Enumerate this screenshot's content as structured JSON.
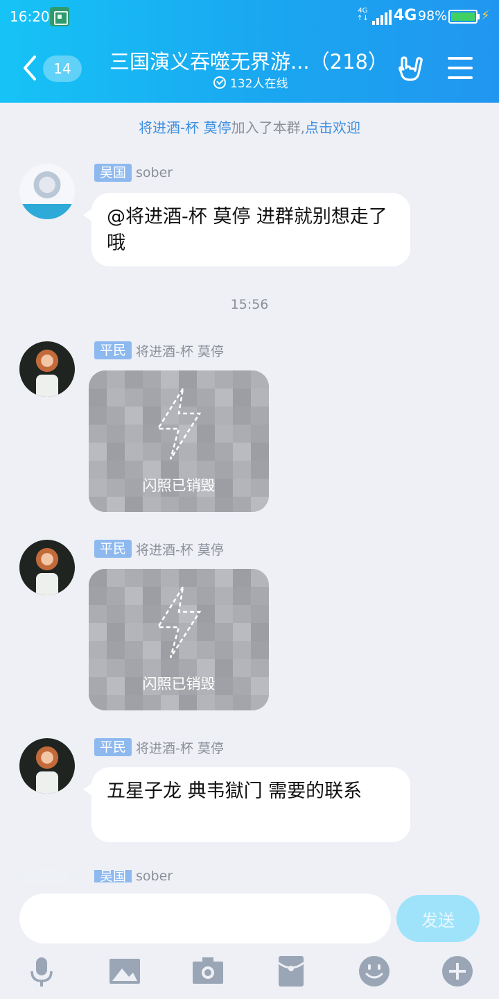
{
  "status_bar": {
    "time": "16:20",
    "network_small_top": "4G",
    "network_small_bottom": "↑↓",
    "network": "4G",
    "battery": "98%"
  },
  "header": {
    "unread_count": "14",
    "title": "三国演义吞噬无界游...（218）",
    "online": "132人在线"
  },
  "chat": {
    "system_message": {
      "user": "将进酒-杯 莫停",
      "text": "加入了本群,",
      "action": "点击欢迎"
    },
    "timestamp": "15:56",
    "messages": [
      {
        "tag": "吴国",
        "name": "sober",
        "text": "@将进酒-杯 莫停  进群就别想走了哦"
      },
      {
        "tag": "平民",
        "name": "将进酒-杯 莫停",
        "flash_text": "闪照已销毁"
      },
      {
        "tag": "平民",
        "name": "将进酒-杯 莫停",
        "flash_text": "闪照已销毁"
      },
      {
        "tag": "平民",
        "name": "将进酒-杯 莫停",
        "text": "五星子龙  典韦獄门  需要的联系"
      },
      {
        "tag": "吴国",
        "name": "sober"
      }
    ]
  },
  "input": {
    "placeholder": "",
    "send_label": "发送"
  },
  "toolbar": {
    "icons": [
      "microphone-icon",
      "image-icon",
      "camera-icon",
      "red-packet-icon",
      "emoji-icon",
      "plus-icon"
    ]
  },
  "colors": {
    "header_start": "#16c3f6",
    "header_end": "#2196f0",
    "tag": "#8db9ef",
    "link": "#3d8fe0",
    "send": "#9fe3fb",
    "background": "#eef0f6"
  }
}
